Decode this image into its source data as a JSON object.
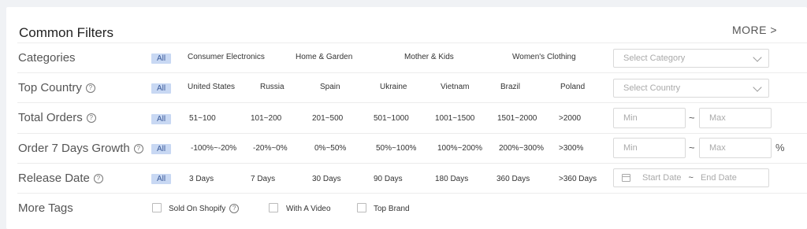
{
  "header": {
    "title": "Common Filters",
    "more_label": "MORE >"
  },
  "rows": {
    "categories": {
      "label": "Categories",
      "options": [
        "All",
        "Consumer Electronics",
        "Home & Garden",
        "Mother & Kids",
        "Women's Clothing"
      ],
      "select_placeholder": "Select Category"
    },
    "top_country": {
      "label": "Top Country",
      "options": [
        "All",
        "United States",
        "Russia",
        "Spain",
        "Ukraine",
        "Vietnam",
        "Brazil",
        "Poland"
      ],
      "select_placeholder": "Select Country"
    },
    "total_orders": {
      "label": "Total Orders",
      "options": [
        "All",
        "51~100",
        "101~200",
        "201~500",
        "501~1000",
        "1001~1500",
        "1501~2000",
        ">2000"
      ],
      "min_placeholder": "Min",
      "max_placeholder": "Max",
      "range_sep": "~"
    },
    "order_growth": {
      "label": "Order 7 Days Growth",
      "options": [
        "All",
        "-100%~-20%",
        "-20%~0%",
        "0%~50%",
        "50%~100%",
        "100%~200%",
        "200%~300%",
        ">300%"
      ],
      "min_placeholder": "Min",
      "max_placeholder": "Max",
      "range_sep": "~",
      "unit": "%"
    },
    "release_date": {
      "label": "Release Date",
      "options": [
        "All",
        "3 Days",
        "7 Days",
        "30 Days",
        "90 Days",
        "180 Days",
        "360 Days",
        ">360 Days"
      ],
      "start_placeholder": "Start Date",
      "end_placeholder": "End Date",
      "range_sep": "~"
    },
    "more_tags": {
      "label": "More Tags",
      "tags": [
        "Sold On Shopify",
        "With A Video",
        "Top Brand"
      ]
    }
  },
  "icons": {
    "help": "help-circle-icon",
    "calendar": "calendar-icon",
    "dropdown": "chevron-down-icon"
  },
  "colors": {
    "selected_bg": "#c8d8f3",
    "selected_text": "#3a5a9a"
  }
}
